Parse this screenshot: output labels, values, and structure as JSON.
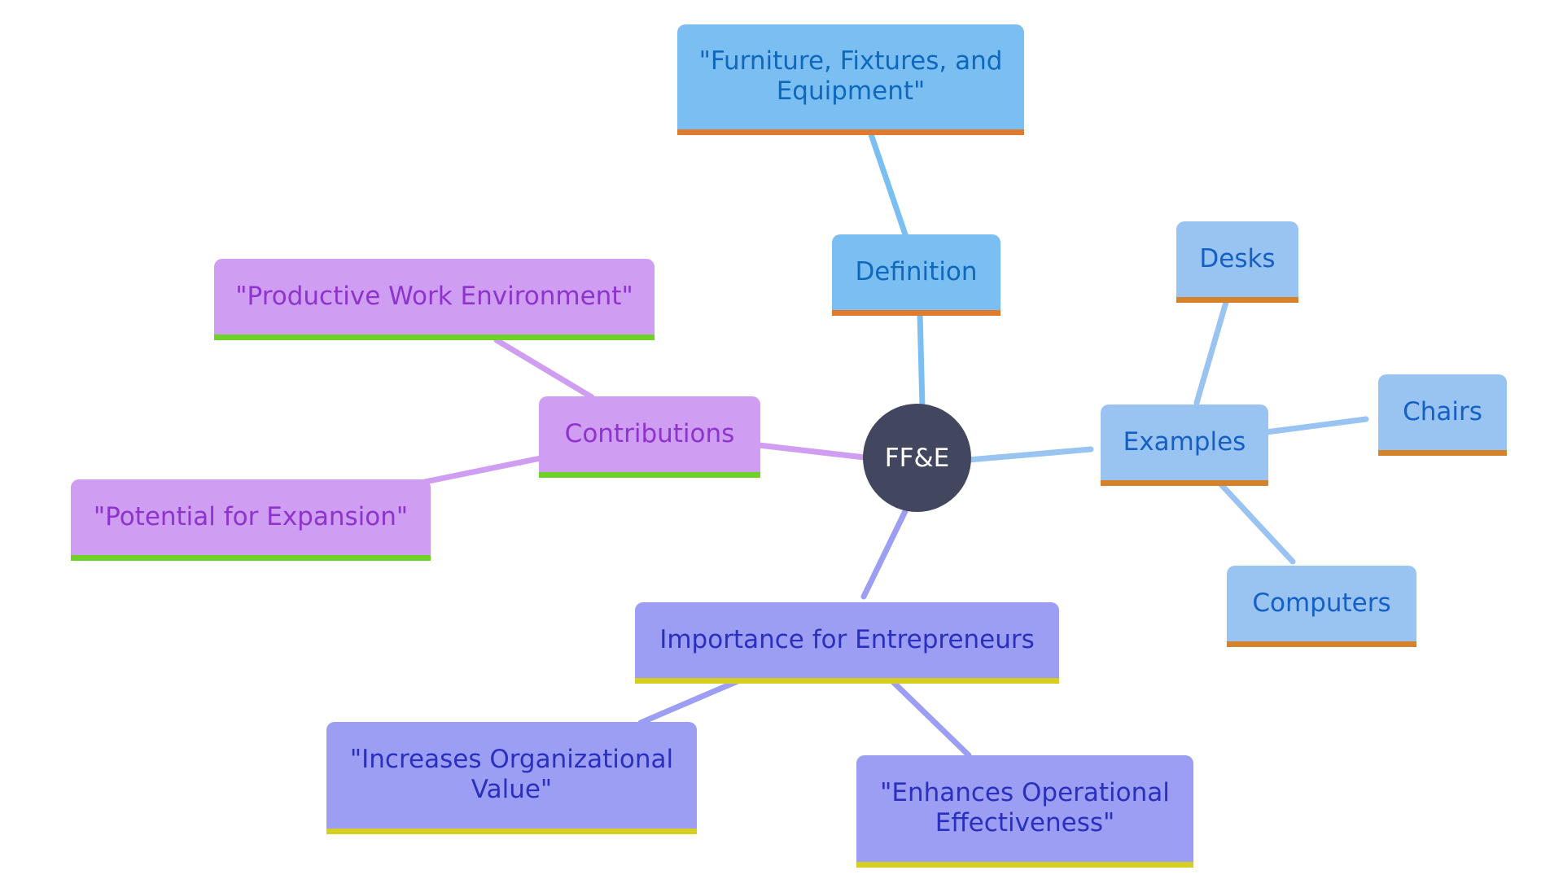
{
  "diagram": {
    "type": "mindmap",
    "root": {
      "label": "FF&E"
    },
    "colors": {
      "root_fill": "#42475f",
      "definition_branch": "#7bbff2",
      "examples_branch": "#99c3f0",
      "contributions_branch": "#cf9df2",
      "importance_branch": "#9b9ef2",
      "orange_underline": "#e07b2e",
      "green_underline": "#6ed125",
      "yellow_underline": "#d6cf22"
    },
    "branches": {
      "definition": {
        "label": "Definition",
        "children": [
          "\"Furniture, Fixtures, and Equipment\""
        ]
      },
      "examples": {
        "label": "Examples",
        "children": [
          "Desks",
          "Chairs",
          "Computers"
        ]
      },
      "contributions": {
        "label": "Contributions",
        "children": [
          "\"Productive Work Environment\"",
          "\"Potential for Expansion\""
        ]
      },
      "importance": {
        "label": "Importance for Entrepreneurs",
        "children": [
          "\"Increases Organizational Value\"",
          "\"Enhances Operational Effectiveness\""
        ]
      }
    }
  }
}
